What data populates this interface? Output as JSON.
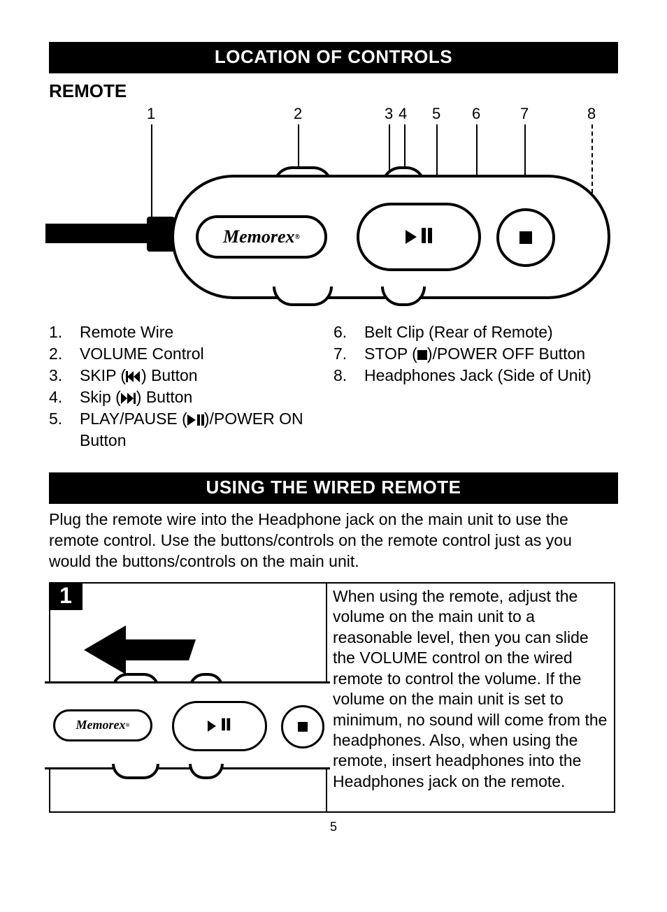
{
  "headers": {
    "section1": "LOCATION OF CONTROLS",
    "sub1": "REMOTE",
    "section2": "USING THE WIRED REMOTE"
  },
  "brand": "Memorex",
  "callouts": [
    "1",
    "2",
    "3",
    "4",
    "5",
    "6",
    "7",
    "8"
  ],
  "legend_left": [
    {
      "n": "1.",
      "t": "Remote Wire"
    },
    {
      "n": "2.",
      "t": "VOLUME Control"
    },
    {
      "n": "3.",
      "t_pre": "SKIP (",
      "t_post": ") Button",
      "icon": "skip-back"
    },
    {
      "n": "4.",
      "t_pre": "Skip (",
      "t_post": ") Button",
      "icon": "skip-fwd"
    },
    {
      "n": "5.",
      "t_pre": "PLAY/PAUSE (",
      "t_post": ")/POWER ON Button",
      "icon": "play-pause"
    }
  ],
  "legend_right": [
    {
      "n": "6.",
      "t": "Belt Clip (Rear of Remote)"
    },
    {
      "n": "7.",
      "t_pre": "STOP (",
      "t_post": ")/POWER OFF Button",
      "icon": "stop"
    },
    {
      "n": "8.",
      "t": "Headphones Jack (Side of Unit)"
    }
  ],
  "wired_intro": "Plug the remote wire into the Headphone jack on the main unit to use the remote control. Use the buttons/controls on the remote control just as you would the buttons/controls on the main unit.",
  "step_num": "1",
  "step_text": "When using the remote, adjust the volume on the main unit to a reasonable level, then you can slide the VOLUME control on the wired remote to control the volume. If the volume on the main unit is set to minimum, no sound will come from the headphones. Also, when using the remote, insert headphones into the Headphones jack on the remote.",
  "page_number": "5"
}
